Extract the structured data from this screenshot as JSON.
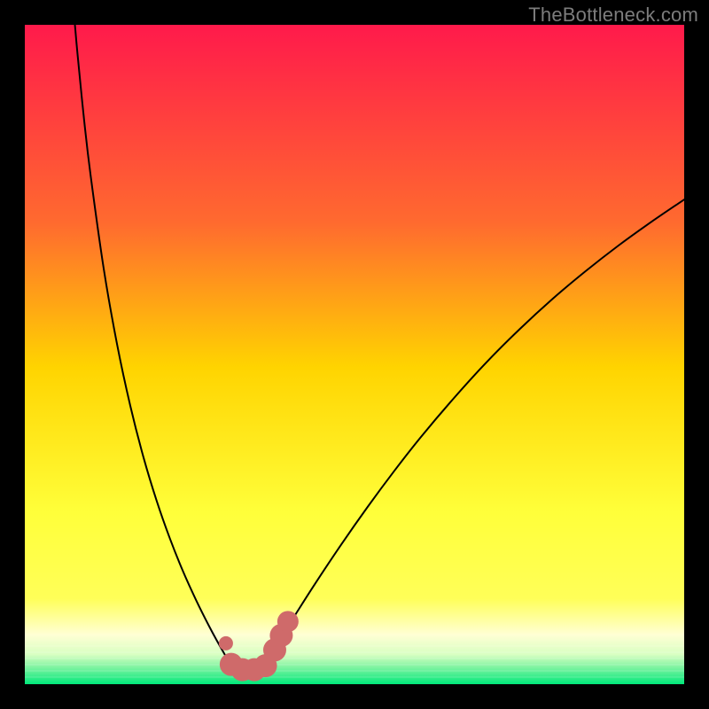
{
  "watermark": "TheBottleneck.com",
  "colors": {
    "frame": "#000000",
    "watermark": "#7c7c7c",
    "gradient_top": "#ff1a4b",
    "gradient_mid_upper": "#ff8a2a",
    "gradient_mid": "#ffd400",
    "gradient_lower": "#ffff58",
    "gradient_pale": "#ffffd4",
    "gradient_green": "#00e87a",
    "curve": "#000000",
    "marker_fill": "#cf6a6a",
    "marker_edge": "#cf6a6a"
  },
  "chart_data": {
    "type": "line",
    "title": "",
    "xlabel": "",
    "ylabel": "",
    "xlim": [
      0,
      100
    ],
    "ylim": [
      0,
      100
    ],
    "background": "red-yellow-green vertical gradient",
    "series": [
      {
        "name": "left-branch",
        "x": [
          7.6,
          8,
          9,
          10,
          12,
          14,
          16,
          18,
          20,
          22,
          24,
          26,
          28,
          29.3,
          30.5
        ],
        "values": [
          100,
          95.5,
          85.5,
          77,
          62.8,
          51.5,
          42.2,
          34.4,
          27.8,
          22.1,
          17.1,
          12.7,
          8.7,
          6.3,
          4.2
        ]
      },
      {
        "name": "right-branch",
        "x": [
          37.5,
          39,
          41,
          44,
          48,
          52,
          56,
          60,
          65,
          70,
          75,
          80,
          85,
          90,
          95,
          100
        ],
        "values": [
          5,
          7.3,
          10.5,
          15.2,
          21.2,
          26.9,
          32.3,
          37.4,
          43.3,
          48.8,
          53.8,
          58.4,
          62.6,
          66.5,
          70.1,
          73.5
        ]
      },
      {
        "name": "valley-floor",
        "x": [
          30.5,
          32,
          34,
          36,
          37.5
        ],
        "values": [
          4.2,
          2.6,
          2.2,
          2.7,
          5
        ]
      }
    ],
    "markers": [
      {
        "name": "left-dot",
        "x": 30.5,
        "y": 6.2,
        "size": 8
      },
      {
        "name": "valley-blob-1",
        "x": 31.3,
        "y": 3.0,
        "size": 13
      },
      {
        "name": "valley-blob-2",
        "x": 33.0,
        "y": 2.2,
        "size": 13
      },
      {
        "name": "valley-blob-3",
        "x": 34.8,
        "y": 2.2,
        "size": 13
      },
      {
        "name": "valley-blob-4",
        "x": 36.5,
        "y": 2.8,
        "size": 13
      },
      {
        "name": "right-blob-1",
        "x": 37.9,
        "y": 5.2,
        "size": 13
      },
      {
        "name": "right-blob-2",
        "x": 38.9,
        "y": 7.4,
        "size": 13
      },
      {
        "name": "right-blob-3",
        "x": 39.9,
        "y": 9.5,
        "size": 12
      }
    ]
  }
}
